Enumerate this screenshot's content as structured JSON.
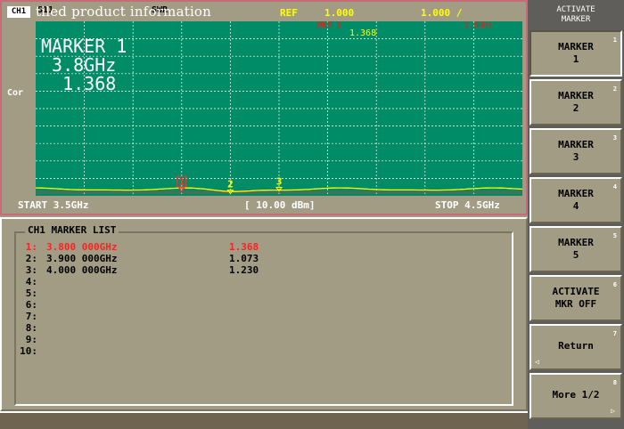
{
  "topbar": {
    "channel": "CH1",
    "param": "S11",
    "format": "SWR",
    "overlay_title": "tiled product information",
    "ref_label": "REF",
    "ref_value": "1.000",
    "scale_value": "1.000 /"
  },
  "plot": {
    "marker_readout": "MARKER 1\n 3.8GHz\n  1.368",
    "mkr_header": "MKR  1",
    "mkr_header_value": "1.368",
    "mkr_right": "3.8GHz",
    "cor_label": "Cor",
    "start": "START 3.5GHz",
    "scale": "[ 10.00 dBm]",
    "stop": "STOP 4.5GHz",
    "grid_divisions_x": 10,
    "grid_divisions_y": 10,
    "trace_color": "#ffff00",
    "bg_color": "#008c66"
  },
  "chart_data": {
    "type": "line",
    "x_range": [
      3.5,
      4.5
    ],
    "markers": [
      {
        "id": "1",
        "x": 3.8,
        "y": 1.368
      },
      {
        "id": "2",
        "x": 3.9,
        "y": 1.073
      },
      {
        "id": "3",
        "x": 4.0,
        "y": 1.23
      }
    ]
  },
  "marker_list": {
    "title": "CH1 MARKER LIST",
    "rows": [
      {
        "num": "1:",
        "freq": "3.800 000GHz",
        "value": "1.368",
        "active": true
      },
      {
        "num": "2:",
        "freq": "3.900 000GHz",
        "value": "1.073",
        "active": false
      },
      {
        "num": "3:",
        "freq": "4.000 000GHz",
        "value": "1.230",
        "active": false
      },
      {
        "num": "4:",
        "freq": "",
        "value": "",
        "active": false
      },
      {
        "num": "5:",
        "freq": "",
        "value": "",
        "active": false
      },
      {
        "num": "6:",
        "freq": "",
        "value": "",
        "active": false
      },
      {
        "num": "7:",
        "freq": "",
        "value": "",
        "active": false
      },
      {
        "num": "8:",
        "freq": "",
        "value": "",
        "active": false
      },
      {
        "num": "9:",
        "freq": "",
        "value": "",
        "active": false
      },
      {
        "num": "10:",
        "freq": "",
        "value": "",
        "active": false
      }
    ]
  },
  "softkeys": {
    "header": "ACTIVATE\nMARKER",
    "keys": [
      {
        "label": "MARKER\n1",
        "index": "1"
      },
      {
        "label": "MARKER\n2",
        "index": "2"
      },
      {
        "label": "MARKER\n3",
        "index": "3"
      },
      {
        "label": "MARKER\n4",
        "index": "4"
      },
      {
        "label": "MARKER\n5",
        "index": "5"
      },
      {
        "label": "ACTIVATE\nMKR OFF",
        "index": "6"
      },
      {
        "label": "Return",
        "index": "7"
      },
      {
        "label": "More 1/2",
        "index": "8"
      }
    ]
  }
}
